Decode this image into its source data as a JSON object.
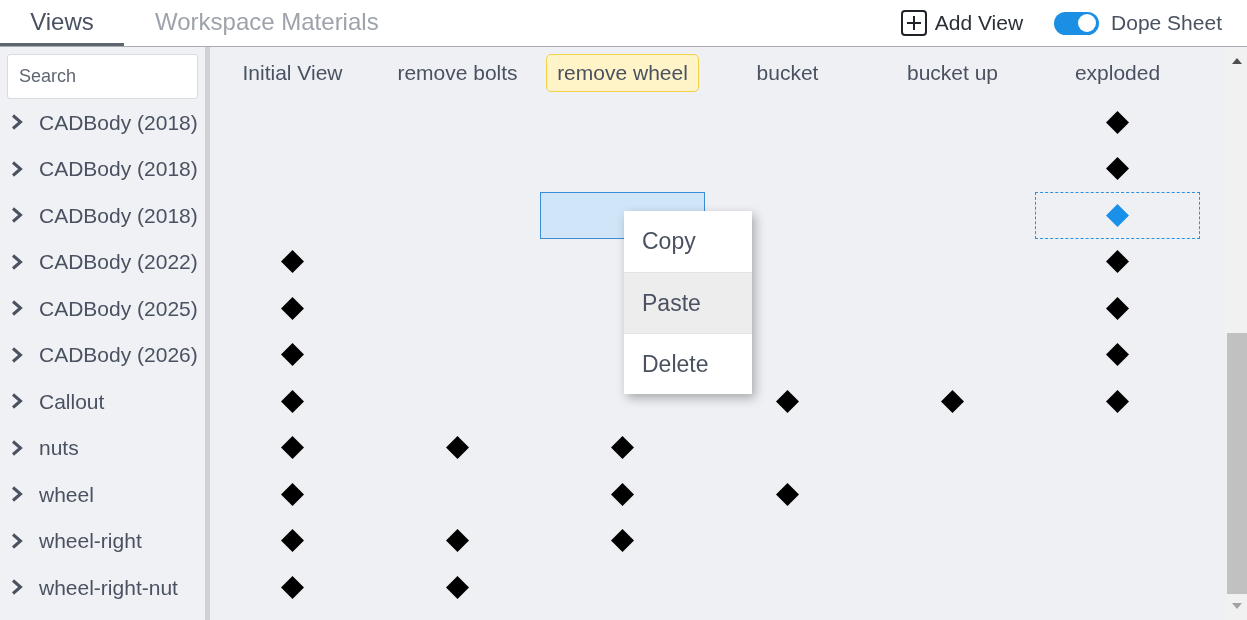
{
  "tabs": [
    {
      "label": "Views",
      "selected": true
    },
    {
      "label": "Workspace Materials",
      "selected": false
    }
  ],
  "toolbar": {
    "add_view": "Add View",
    "dope_sheet": {
      "label": "Dope Sheet",
      "on": true
    }
  },
  "search": {
    "placeholder": "Search"
  },
  "views": [
    {
      "label": "Initial View",
      "selected": false
    },
    {
      "label": "remove bolts",
      "selected": false
    },
    {
      "label": "remove wheel",
      "selected": true
    },
    {
      "label": "bucket",
      "selected": false
    },
    {
      "label": "bucket up",
      "selected": false
    },
    {
      "label": "exploded",
      "selected": false
    }
  ],
  "tracks": [
    {
      "label": "CADBody (2018)",
      "expanded": false,
      "cells": [
        {
          "key": false,
          "selected": false,
          "copied": false
        },
        {
          "key": false,
          "selected": false,
          "copied": false
        },
        {
          "key": false,
          "selected": false,
          "copied": false
        },
        {
          "key": false,
          "selected": false,
          "copied": false
        },
        {
          "key": false,
          "selected": false,
          "copied": false
        },
        {
          "key": true,
          "selected": false,
          "copied": false
        }
      ]
    },
    {
      "label": "CADBody (2018)",
      "expanded": false,
      "cells": [
        {
          "key": false,
          "selected": false,
          "copied": false
        },
        {
          "key": false,
          "selected": false,
          "copied": false
        },
        {
          "key": false,
          "selected": false,
          "copied": false
        },
        {
          "key": false,
          "selected": false,
          "copied": false
        },
        {
          "key": false,
          "selected": false,
          "copied": false
        },
        {
          "key": true,
          "selected": false,
          "copied": false
        }
      ]
    },
    {
      "label": "CADBody (2018)",
      "expanded": false,
      "cells": [
        {
          "key": false,
          "selected": false,
          "copied": false
        },
        {
          "key": false,
          "selected": false,
          "copied": false
        },
        {
          "key": false,
          "selected": true,
          "copied": false
        },
        {
          "key": false,
          "selected": false,
          "copied": false
        },
        {
          "key": false,
          "selected": false,
          "copied": false
        },
        {
          "key": true,
          "selected": false,
          "copied": true
        }
      ]
    },
    {
      "label": "CADBody (2022)",
      "expanded": false,
      "cells": [
        {
          "key": true,
          "selected": false,
          "copied": false
        },
        {
          "key": false,
          "selected": false,
          "copied": false
        },
        {
          "key": false,
          "selected": false,
          "copied": false
        },
        {
          "key": false,
          "selected": false,
          "copied": false
        },
        {
          "key": false,
          "selected": false,
          "copied": false
        },
        {
          "key": true,
          "selected": false,
          "copied": false
        }
      ]
    },
    {
      "label": "CADBody (2025)",
      "expanded": false,
      "cells": [
        {
          "key": true,
          "selected": false,
          "copied": false
        },
        {
          "key": false,
          "selected": false,
          "copied": false
        },
        {
          "key": false,
          "selected": false,
          "copied": false
        },
        {
          "key": false,
          "selected": false,
          "copied": false
        },
        {
          "key": false,
          "selected": false,
          "copied": false
        },
        {
          "key": true,
          "selected": false,
          "copied": false
        }
      ]
    },
    {
      "label": "CADBody (2026)",
      "expanded": false,
      "cells": [
        {
          "key": true,
          "selected": false,
          "copied": false
        },
        {
          "key": false,
          "selected": false,
          "copied": false
        },
        {
          "key": false,
          "selected": false,
          "copied": false
        },
        {
          "key": false,
          "selected": false,
          "copied": false
        },
        {
          "key": false,
          "selected": false,
          "copied": false
        },
        {
          "key": true,
          "selected": false,
          "copied": false
        }
      ]
    },
    {
      "label": "Callout",
      "expanded": false,
      "cells": [
        {
          "key": true,
          "selected": false,
          "copied": false
        },
        {
          "key": false,
          "selected": false,
          "copied": false
        },
        {
          "key": false,
          "selected": false,
          "copied": false
        },
        {
          "key": true,
          "selected": false,
          "copied": false
        },
        {
          "key": true,
          "selected": false,
          "copied": false
        },
        {
          "key": true,
          "selected": false,
          "copied": false
        }
      ]
    },
    {
      "label": "nuts",
      "expanded": false,
      "cells": [
        {
          "key": true,
          "selected": false,
          "copied": false
        },
        {
          "key": true,
          "selected": false,
          "copied": false
        },
        {
          "key": true,
          "selected": false,
          "copied": false
        },
        {
          "key": false,
          "selected": false,
          "copied": false
        },
        {
          "key": false,
          "selected": false,
          "copied": false
        },
        {
          "key": false,
          "selected": false,
          "copied": false
        }
      ]
    },
    {
      "label": "wheel",
      "expanded": false,
      "cells": [
        {
          "key": true,
          "selected": false,
          "copied": false
        },
        {
          "key": false,
          "selected": false,
          "copied": false
        },
        {
          "key": true,
          "selected": false,
          "copied": false
        },
        {
          "key": true,
          "selected": false,
          "copied": false
        },
        {
          "key": false,
          "selected": false,
          "copied": false
        },
        {
          "key": false,
          "selected": false,
          "copied": false
        }
      ]
    },
    {
      "label": "wheel-right",
      "expanded": false,
      "cells": [
        {
          "key": true,
          "selected": false,
          "copied": false
        },
        {
          "key": true,
          "selected": false,
          "copied": false
        },
        {
          "key": true,
          "selected": false,
          "copied": false
        },
        {
          "key": false,
          "selected": false,
          "copied": false
        },
        {
          "key": false,
          "selected": false,
          "copied": false
        },
        {
          "key": false,
          "selected": false,
          "copied": false
        }
      ]
    },
    {
      "label": "wheel-right-nut",
      "expanded": false,
      "cells": [
        {
          "key": true,
          "selected": false,
          "copied": false
        },
        {
          "key": true,
          "selected": false,
          "copied": false
        },
        {
          "key": false,
          "selected": false,
          "copied": false
        },
        {
          "key": false,
          "selected": false,
          "copied": false
        },
        {
          "key": false,
          "selected": false,
          "copied": false
        },
        {
          "key": false,
          "selected": false,
          "copied": false
        }
      ]
    }
  ],
  "context_menu": {
    "items": [
      {
        "label": "Copy",
        "highlighted": false
      },
      {
        "label": "Paste",
        "highlighted": true
      },
      {
        "label": "Delete",
        "highlighted": false
      }
    ]
  }
}
